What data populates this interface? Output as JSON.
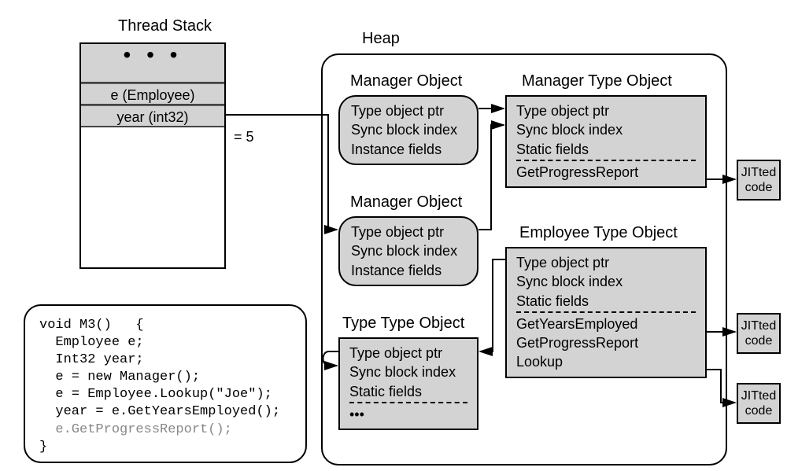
{
  "stack": {
    "title": "Thread Stack",
    "dots": "• • •",
    "row1": "e (Employee)",
    "row2": "year (int32)",
    "value": "=   5"
  },
  "heap": {
    "title": "Heap"
  },
  "mgrObj1": {
    "title": "Manager Object",
    "l1": "Type object ptr",
    "l2": "Sync block index",
    "l3": "Instance fields"
  },
  "mgrObj2": {
    "title": "Manager Object",
    "l1": "Type object ptr",
    "l2": "Sync block index",
    "l3": "Instance fields"
  },
  "typeTypeObj": {
    "title": "Type Type Object",
    "l1": "Type object ptr",
    "l2": "Sync block index",
    "l3": "Static fields",
    "dots": "•••"
  },
  "mgrTypeObj": {
    "title": "Manager Type Object",
    "l1": "Type object ptr",
    "l2": "Sync block index",
    "l3": "Static fields",
    "m1": "GetProgressReport"
  },
  "empTypeObj": {
    "title": "Employee Type Object",
    "l1": "Type object ptr",
    "l2": "Sync block index",
    "l3": "Static fields",
    "m1": "GetYearsEmployed",
    "m2": "GetProgressReport",
    "m3": "Lookup"
  },
  "jit": {
    "j1a": "JITted",
    "j1b": "code",
    "j2a": "JITted",
    "j2b": "code",
    "j3a": "JITted",
    "j3b": "code"
  },
  "code": {
    "sig": "void M3()   {",
    "l1": "  Employee e;",
    "l2": "  Int32 year;",
    "l3": "  e = new Manager();",
    "l4": "  e = Employee.Lookup(\"Joe\");",
    "l5": "  year = e.GetYearsEmployed();",
    "hl": "  e.GetProgressReport();",
    "end": "}"
  }
}
